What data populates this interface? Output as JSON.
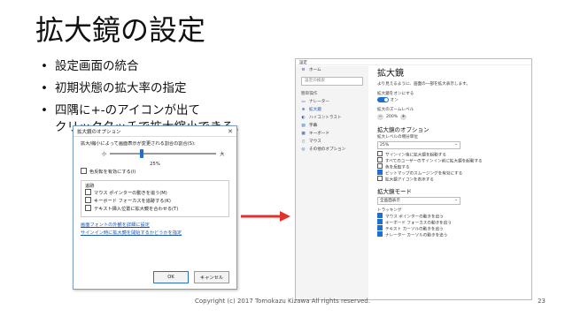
{
  "slide": {
    "title": "拡大鏡の設定",
    "bullets": [
      "設定画面の統合",
      "初期状態の拡大率の指定",
      "四隅に+-のアイコンが出て\nクリックタッチで拡大縮小できる。"
    ],
    "bullet_glyph": "•",
    "footer": "Copyright (c) 2017 Tomokazu Kizawa All rights reserved.",
    "page_number": "23",
    "arrow_color": "#e0322b"
  },
  "dialog": {
    "title": "拡大鏡のオプション",
    "close_icon": "close-icon",
    "zoom_label": "拡大/縮小によって画面表示が変更される割合の割合(S):",
    "slider_min": "小",
    "slider_max": "大",
    "slider_value": 0.25,
    "percent": "25%",
    "color_invert": "色反転を有効にする(I)",
    "tracking_header": "追跡",
    "tracking_items": [
      "マウス ポインターの動きを追う(M)",
      "キーボード フォーカスを追跡する(K)",
      "テキスト挿入位置に拡大鏡を合わせる(T)"
    ],
    "link1": "画面フォントの外観を詳細に設定",
    "link2": "サインイン時に拡大鏡を開始するかどうかを指定",
    "ok": "OK",
    "cancel": "キャンセル"
  },
  "settings": {
    "window_title": "設定",
    "nav": {
      "home": "ホーム",
      "search_placeholder": "設定の検索",
      "section": "簡単操作",
      "items": [
        "ナレーター",
        "拡大鏡",
        "ハイコントラスト",
        "字幕",
        "キーボード",
        "マウス",
        "その他のオプション"
      ],
      "active_index": 1
    },
    "main": {
      "title": "拡大鏡",
      "desc": "より見えるように、画面の一部を拡大表示します。",
      "toggle_label": "拡大鏡をオンにする",
      "toggle_state": "オン",
      "zoom_label": "拡大のズームレベル",
      "zoom_value": "200%",
      "options_header": "拡大鏡のオプション",
      "increment_label": "拡大レベルの増分単位",
      "increment_value": "25%",
      "options": [
        {
          "label": "サインイン後に拡大鏡を起動する",
          "checked": false
        },
        {
          "label": "すべてのユーザーのサインイン前に拡大鏡を起動する",
          "checked": false
        },
        {
          "label": "色を反転する",
          "checked": false
        },
        {
          "label": "ビットマップのスムージングを有効にする",
          "checked": true
        },
        {
          "label": "拡大鏡アイコンを表示する",
          "checked": false
        }
      ],
      "mode_header": "拡大鏡モード",
      "mode_value": "全画面表示",
      "tracking_header": "トラッキング",
      "tracking": [
        {
          "label": "マウス ポインターの動きを追う",
          "checked": true
        },
        {
          "label": "キーボード フォーカスの動きを追う",
          "checked": true
        },
        {
          "label": "テキスト カーソルの動きを追う",
          "checked": true
        },
        {
          "label": "ナレーター カーソルの動きを追う",
          "checked": true
        }
      ]
    }
  }
}
